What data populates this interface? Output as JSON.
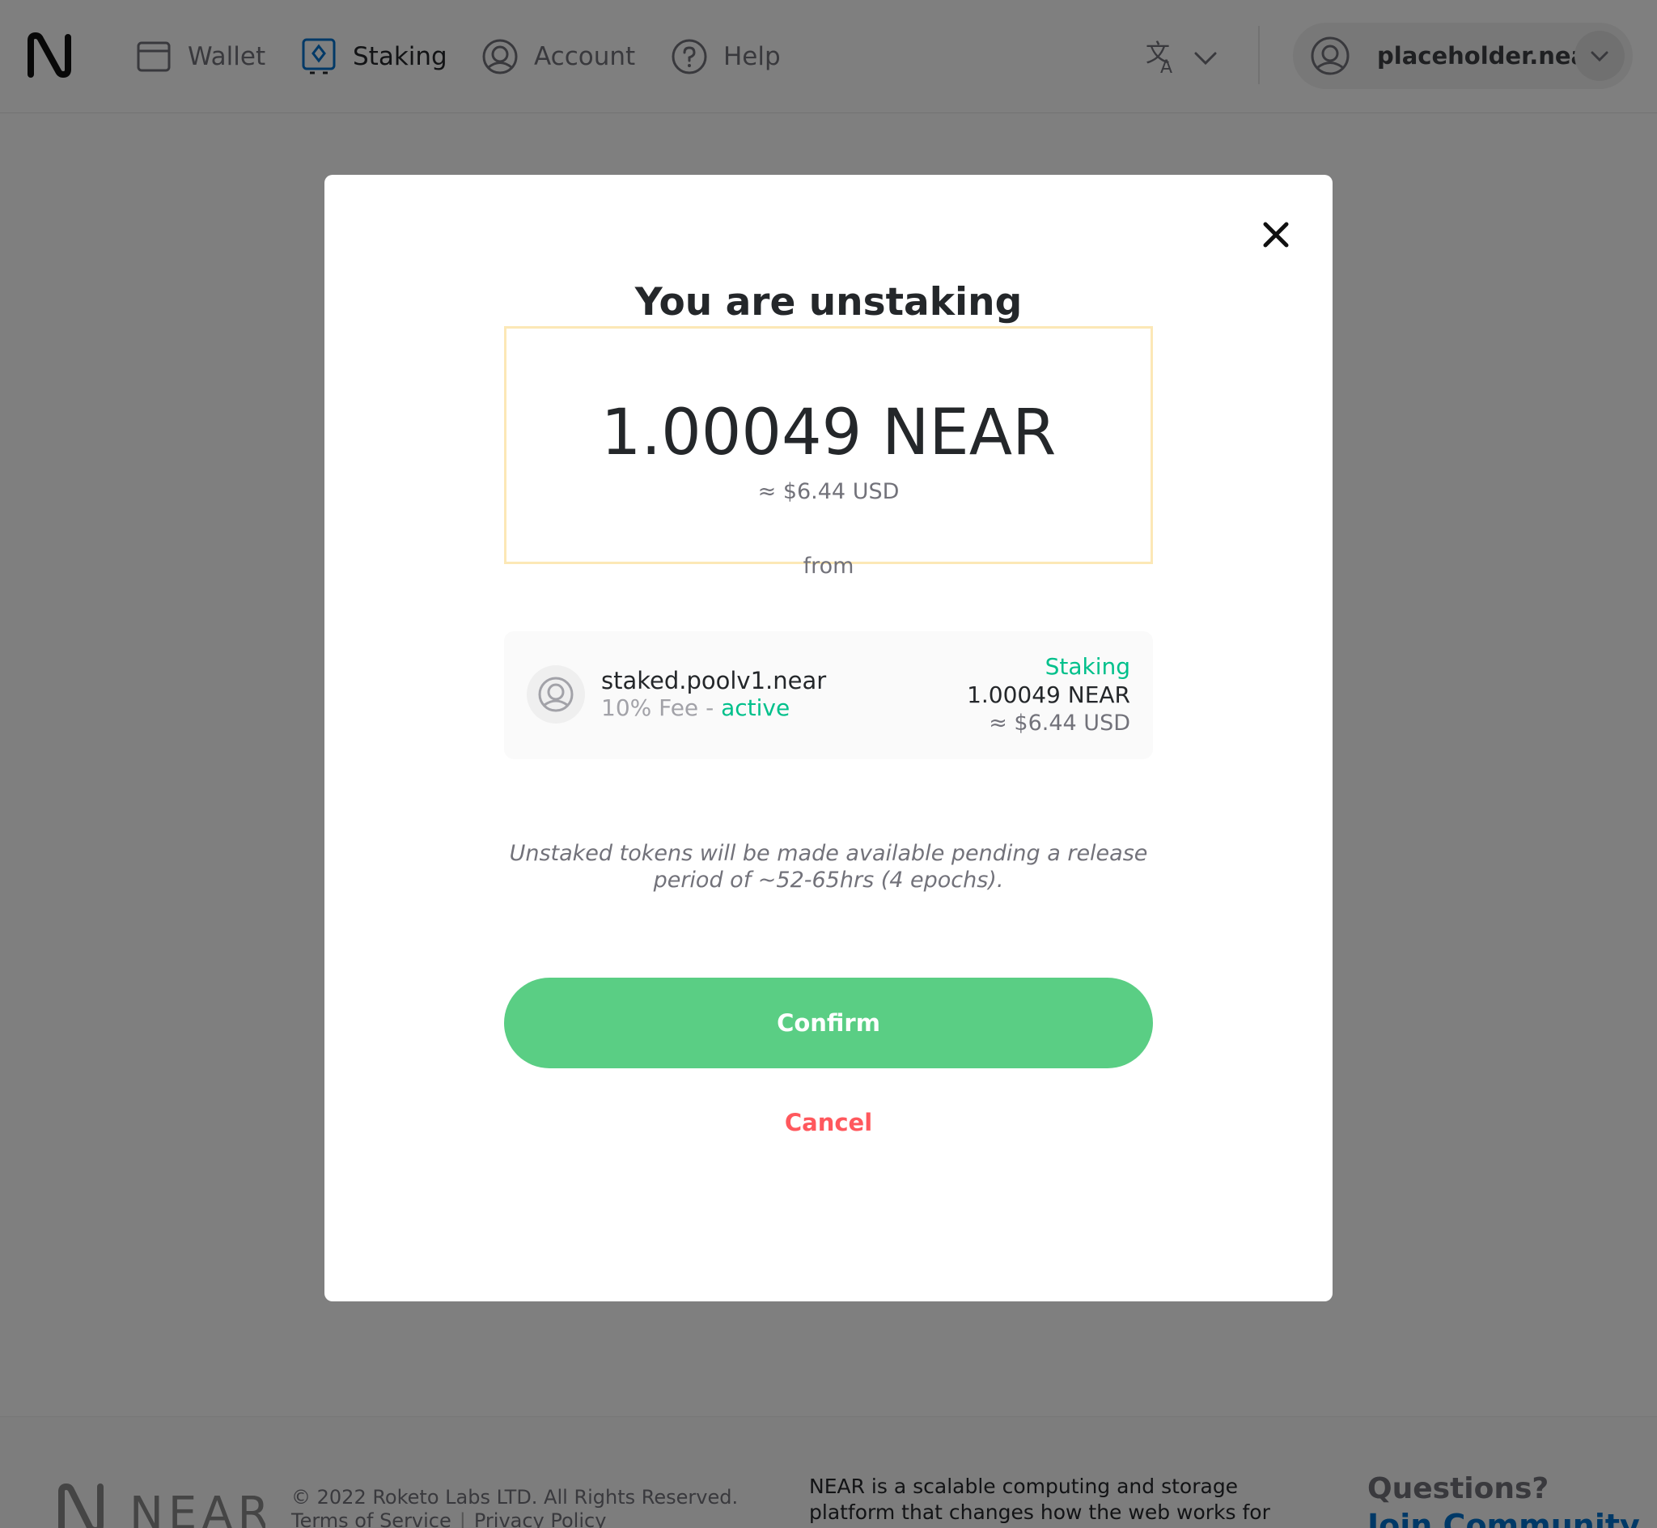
{
  "header": {
    "nav": [
      {
        "label": "Wallet",
        "icon": "wallet-icon"
      },
      {
        "label": "Staking",
        "icon": "staking-icon"
      },
      {
        "label": "Account",
        "icon": "account-icon"
      },
      {
        "label": "Help",
        "icon": "help-icon"
      }
    ],
    "account_name": "placeholder.near"
  },
  "modal": {
    "title": "You are unstaking",
    "amount": "1.00049 NEAR",
    "amount_usd": "≈ $6.44 USD",
    "from": "from",
    "validator": {
      "name": "staked.poolv1.near",
      "fee": "10% Fee",
      "fee_sep": " - ",
      "state": "active",
      "status": "Staking",
      "amount": "1.00049 NEAR",
      "amount_usd": "≈ $6.44 USD"
    },
    "note_line1": "Unstaked tokens will be made available pending a release",
    "note_line2": "period of ~52-65hrs (4 epochs).",
    "confirm": "Confirm",
    "cancel": "Cancel"
  },
  "footer": {
    "copyright": "© 2022 Roketo Labs LTD. All Rights Reserved.",
    "terms": "Terms of Service",
    "privacy": "Privacy Policy",
    "description": "NEAR is a scalable computing and storage platform that changes how the web works for the",
    "questions": "Questions?",
    "join": "Join Community"
  },
  "colors": {
    "accent_green": "#5ace84",
    "active_green": "#00c08b",
    "cancel_red": "#ff585d",
    "highlight_border": "#fce8b6",
    "overlay": "rgba(0,0,0,0.5)"
  }
}
